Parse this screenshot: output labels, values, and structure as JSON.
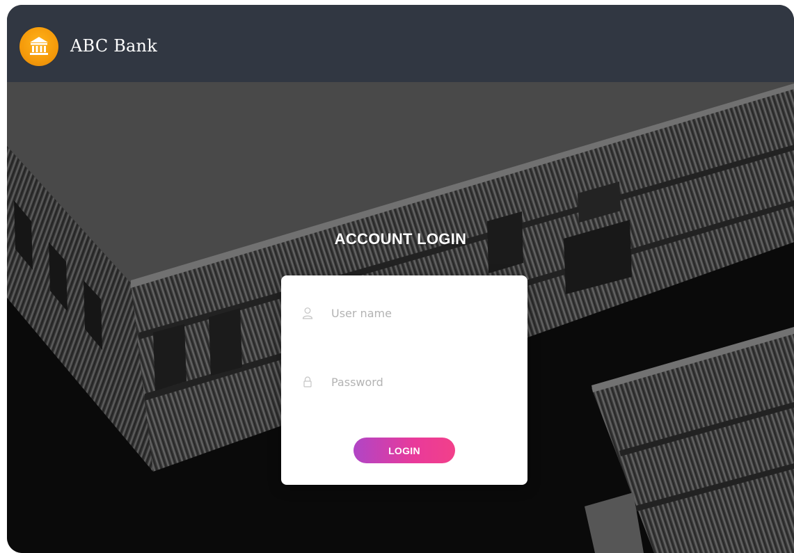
{
  "header": {
    "brand_name": "ABC Bank",
    "logo_icon": "bank-building-icon",
    "logo_color": "#F7A10F",
    "bar_color": "#313742"
  },
  "login": {
    "title": "ACCOUNT LOGIN",
    "username": {
      "placeholder": "User name",
      "value": "",
      "icon": "user-icon"
    },
    "password": {
      "placeholder": "Password",
      "value": "",
      "icon": "lock-icon"
    },
    "submit_label": "LOGIN",
    "button_gradient": [
      "#B045C6",
      "#F2408A"
    ]
  }
}
